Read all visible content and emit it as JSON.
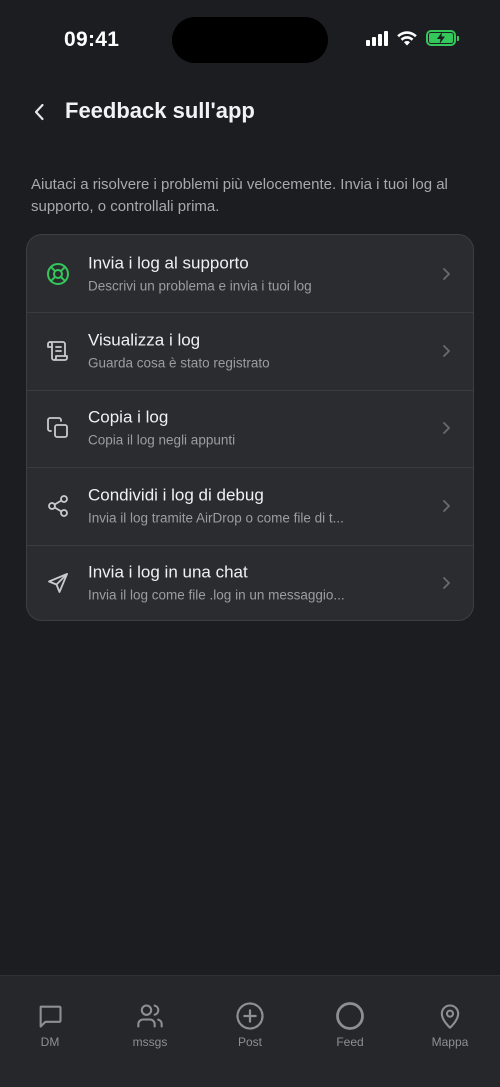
{
  "status_bar": {
    "time": "09:41"
  },
  "header": {
    "title": "Feedback sull'app"
  },
  "description": "Aiutaci a risolvere i problemi più velocemente. Invia i tuoi log al supporto, o controllali prima.",
  "colors": {
    "accent_green": "#34c759",
    "background": "#1c1d21",
    "card": "#2b2c30"
  },
  "menu": [
    {
      "icon": "lifebuoy-icon",
      "title": "Invia i log al supporto",
      "subtitle": "Descrivi un problema e invia i tuoi log"
    },
    {
      "icon": "scroll-icon",
      "title": "Visualizza i log",
      "subtitle": "Guarda cosa è stato registrato"
    },
    {
      "icon": "copy-icon",
      "title": "Copia i log",
      "subtitle": "Copia il log negli appunti"
    },
    {
      "icon": "share-icon",
      "title": "Condividi i log di debug",
      "subtitle": "Invia il log tramite AirDrop o come file di t..."
    },
    {
      "icon": "send-icon",
      "title": "Invia i log in una chat",
      "subtitle": "Invia il log come file .log in un messaggio..."
    }
  ],
  "tabs": [
    {
      "icon": "message-square-icon",
      "label": "DM"
    },
    {
      "icon": "users-icon",
      "label": "mssgs"
    },
    {
      "icon": "plus-circle-icon",
      "label": "Post"
    },
    {
      "icon": "circle-icon",
      "label": "Feed"
    },
    {
      "icon": "map-pin-icon",
      "label": "Mappa"
    }
  ]
}
